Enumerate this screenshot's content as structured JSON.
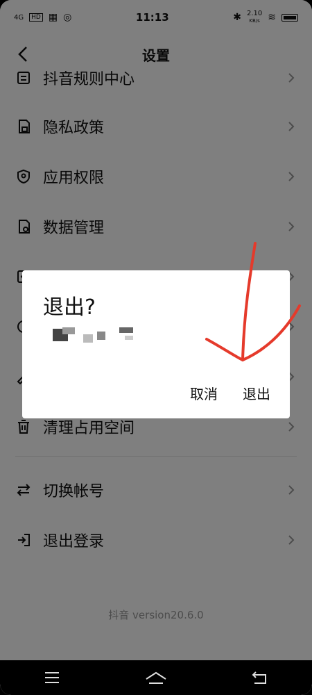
{
  "status_bar": {
    "time": "11:13",
    "signal": "4G",
    "speed_value": "2.10",
    "speed_unit": "KB/s"
  },
  "header": {
    "title": "设置"
  },
  "list": {
    "items": [
      {
        "label": "抖音规则中心",
        "icon": "rules-icon"
      },
      {
        "label": "隐私政策",
        "icon": "lock-file-icon"
      },
      {
        "label": "应用权限",
        "icon": "shield-icon"
      },
      {
        "label": "数据管理",
        "icon": "data-file-icon"
      },
      {
        "label": "",
        "icon": "app-icon"
      },
      {
        "label": "",
        "icon": "clock-icon"
      },
      {
        "label": "",
        "icon": "edit-icon"
      },
      {
        "label": "清理占用空间",
        "icon": "trash-icon"
      },
      {
        "label": "切换帐号",
        "icon": "switch-icon"
      },
      {
        "label": "退出登录",
        "icon": "logout-icon"
      }
    ]
  },
  "footer": {
    "version": "抖音 version20.6.0"
  },
  "dialog": {
    "title": "退出?",
    "cancel_label": "取消",
    "confirm_label": "退出"
  },
  "annotation": {
    "color": "#e53a2b"
  }
}
